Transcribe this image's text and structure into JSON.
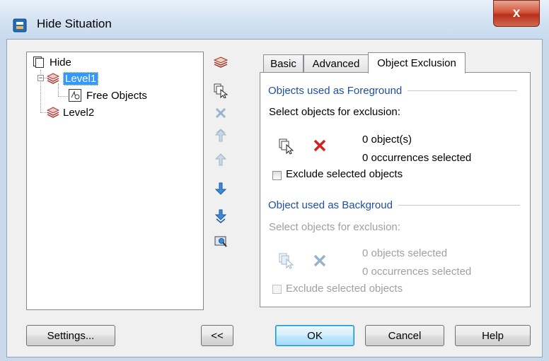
{
  "window": {
    "title": "Hide Situation",
    "close_glyph": "x"
  },
  "tree": {
    "root": "Hide",
    "items": [
      {
        "label": "Level1",
        "selected": true,
        "children": [
          {
            "label": "Free Objects"
          }
        ]
      },
      {
        "label": "Level2",
        "selected": false,
        "children": []
      }
    ]
  },
  "toolbar": {
    "buttons": [
      "add-level-icon",
      "select-objects-icon",
      "delete-icon",
      "move-top-icon",
      "move-up-icon",
      "move-down-icon",
      "move-bottom-icon",
      "preview-icon"
    ]
  },
  "tabs": [
    {
      "label": "Basic",
      "active": false
    },
    {
      "label": "Advanced",
      "active": false
    },
    {
      "label": "Object Exclusion",
      "active": true
    }
  ],
  "foreground": {
    "header": "Objects used as Foreground",
    "prompt": "Select objects for exclusion:",
    "count_text": "0 object(s)",
    "occurrences_text": "0 occurrences selected",
    "checkbox_label": "Exclude selected objects",
    "checked": false
  },
  "background": {
    "header": "Object used as Backgroud",
    "prompt": "Select objects for exclusion:",
    "count_text": "0 objects selected",
    "occurrences_text": "0 occurrences selected",
    "checkbox_label": "Exclude selected objects",
    "checked": false,
    "enabled": false
  },
  "buttons": {
    "settings": "Settings...",
    "collapse": "<<",
    "ok": "OK",
    "cancel": "Cancel",
    "help": "Help"
  },
  "colors": {
    "selection": "#3399ff",
    "section_header": "#1f4fa0",
    "delete_red": "#d42020",
    "close_button": "#c74b32"
  }
}
